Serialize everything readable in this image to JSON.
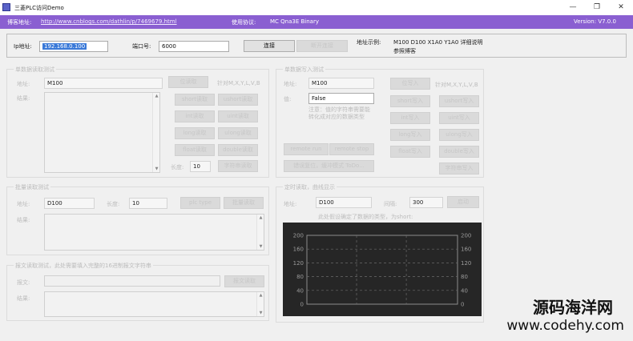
{
  "window": {
    "title": "三菱PLC访问Demo",
    "minimize": "—",
    "maximize": "❐",
    "close": "✕"
  },
  "infobar": {
    "blog_label": "博客地址:",
    "blog_url": "http://www.cnblogs.com/dathlin/p/7469679.html",
    "protocol_label": "使用协议:",
    "protocol_value": "MC Qna3E Binary",
    "version": "Version: V7.0.0"
  },
  "connection": {
    "ip_label": "Ip地址:",
    "ip_value": "192.168.0.100",
    "port_label": "端口号:",
    "port_value": "6000",
    "connect_button": "连接",
    "disconnect_button": "断开连接",
    "example_label": "地址示例:",
    "example_value": "M100 D100 X1A0 Y1A0 详细说明",
    "example_link": "参照博客"
  },
  "single_read": {
    "title": "单数据读取测试",
    "address_label": "地址:",
    "address_value": "M100",
    "result_label": "结果:",
    "length_label": "长度:",
    "length_value": "10",
    "note": "针对M,X,Y,L,V,B",
    "buttons": {
      "bit": "位读取",
      "short": "short读取",
      "ushort": "ushort读取",
      "int": "int读取",
      "uint": "uint读取",
      "long": "long读取",
      "ulong": "ulong读取",
      "float": "float读取",
      "double": "double读取",
      "string": "字符串读取"
    }
  },
  "single_write": {
    "title": "单数据写入测试",
    "address_label": "地址:",
    "address_value": "M100",
    "value_label": "值:",
    "value_value": "False",
    "note": "注意：值的字符串需要能转化成对应的数据类型",
    "note_side": "针对M,X,Y,L,V,B",
    "buttons": {
      "bit": "位写入",
      "short": "short写入",
      "ushort": "ushort写入",
      "int": "int写入",
      "uint": "uint写入",
      "long": "long写入",
      "ulong": "ulong写入",
      "float": "float写入",
      "double": "double写入",
      "string": "字符串写入",
      "remote_run": "remote run",
      "remote_stop": "remote stop",
      "error_reset": "错误复位，缓冲模式 ToDo..."
    }
  },
  "batch_read": {
    "title": "批量读取测试",
    "address_label": "地址:",
    "address_value": "D100",
    "length_label": "长度:",
    "length_value": "10",
    "plc_type_button": "plc type",
    "batch_button": "批量读取",
    "result_label": "结果:"
  },
  "message_read": {
    "title": "报文读取测试，此处需要填入完整的16进制报文字符串",
    "message_label": "报文:",
    "read_button": "报文读取",
    "result_label": "结果:"
  },
  "timed_read": {
    "title": "定时读取，曲线显示",
    "address_label": "地址:",
    "address_value": "D100",
    "interval_label": "间隔:",
    "interval_value": "300",
    "start_button": "启动",
    "hint": "此处假设确定了数据的类型，为short:"
  },
  "chart_data": {
    "type": "line",
    "x": [],
    "series": [],
    "yticks_left": [
      "200",
      "160",
      "120",
      "80",
      "40",
      "0"
    ],
    "yticks_right": [
      "200",
      "160",
      "120",
      "80",
      "40",
      "0"
    ],
    "ylim": [
      0,
      200
    ],
    "grid": true,
    "background": "#262626"
  },
  "watermark": {
    "line1": "源码海洋网",
    "line2": "www.codehy.com"
  },
  "colors": {
    "infobar": "#8a5fd1",
    "chart_bg": "#262626",
    "selection": "#3a79d8"
  }
}
